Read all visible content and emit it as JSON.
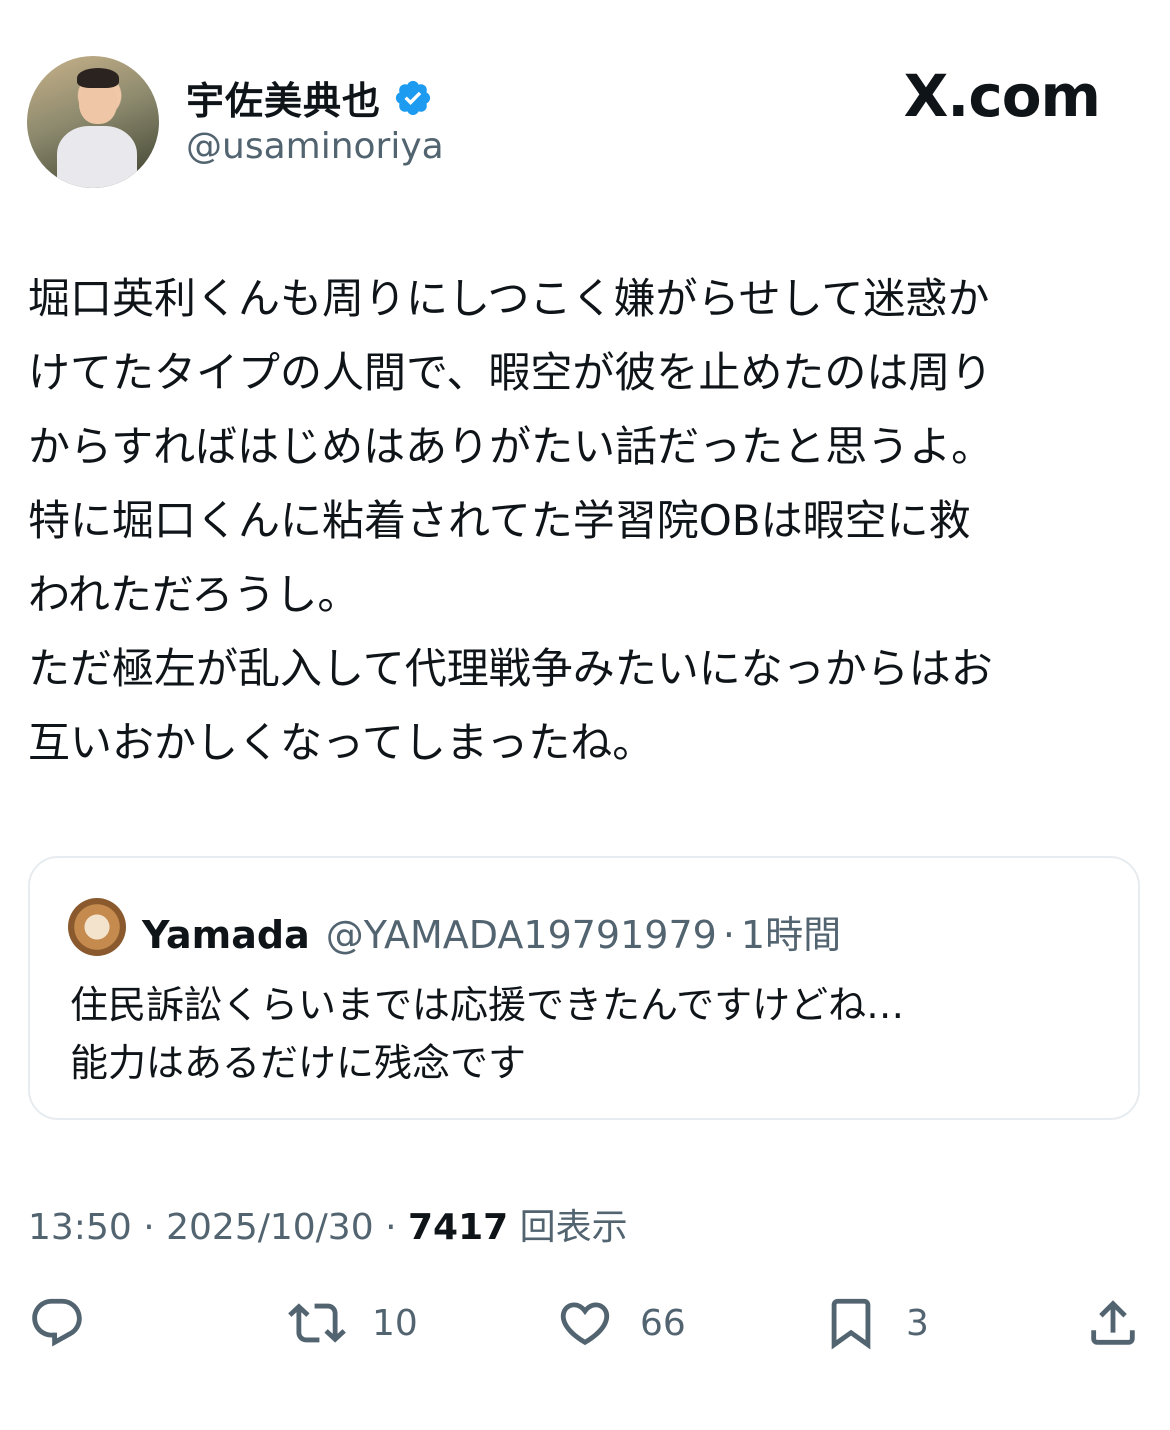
{
  "author": {
    "display_name": "宇佐美典也",
    "handle": "@usaminoriya",
    "verified": true,
    "badge_color": "#1d9bf0"
  },
  "site_label": "X.com",
  "tweet": {
    "text": "堀口英利くんも周りにしつこく嫌がらせして迷惑か\nけてたタイプの人間で、暇空が彼を止めたのは周り\nからすればはじめはありがたい話だったと思うよ。\n特に堀口くんに粘着されてた学習院OBは暇空に救\nわれただろうし。\nただ極左が乱入して代理戦争みたいになっからはお\n互いおかしくなってしまったね。"
  },
  "quote": {
    "name": "Yamada",
    "handle": "@YAMADA19791979",
    "separator": "·",
    "time": "1時間",
    "text": "住民訴訟くらいまでは応援できたんですけどね…\n能力はあるだけに残念です"
  },
  "meta": {
    "time": "13:50",
    "date": "2025/10/30",
    "separator": "·",
    "views": "7417",
    "views_label": "回表示"
  },
  "actions": {
    "reply_count": "",
    "retweet_count": "10",
    "like_count": "66",
    "bookmark_count": "3",
    "icon_color": "#536471"
  }
}
